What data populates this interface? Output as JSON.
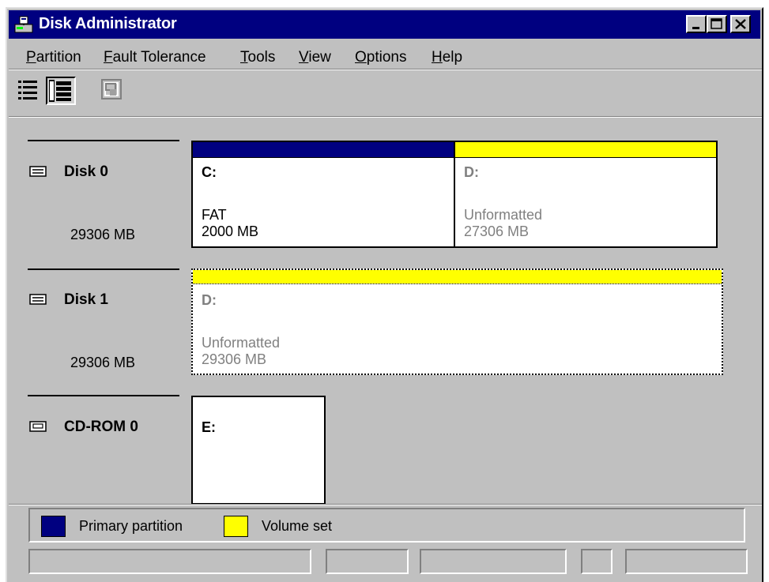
{
  "window": {
    "title": "Disk Administrator"
  },
  "menu": [
    {
      "mnemonic": "P",
      "rest": "artition"
    },
    {
      "mnemonic": "F",
      "rest": "ault Tolerance"
    },
    {
      "mnemonic": "T",
      "rest": "ools"
    },
    {
      "mnemonic": "V",
      "rest": "iew"
    },
    {
      "mnemonic": "O",
      "rest": "ptions"
    },
    {
      "mnemonic": "H",
      "rest": "elp"
    }
  ],
  "disks": [
    {
      "label": "Disk 0",
      "size": "29306 MB",
      "partitions": [
        {
          "drive": "C:",
          "fs": "FAT",
          "size": "2000 MB",
          "type": "Primary partition"
        },
        {
          "drive": "D:",
          "fs": "Unformatted",
          "size": "27306 MB",
          "type": "Volume set"
        }
      ]
    },
    {
      "label": "Disk 1",
      "size": "29306 MB",
      "partitions": [
        {
          "drive": "D:",
          "fs": "Unformatted",
          "size": "29306 MB",
          "type": "Volume set",
          "selected": true
        }
      ]
    },
    {
      "label": "CD-ROM 0",
      "partitions": [
        {
          "drive": "E:"
        }
      ]
    }
  ],
  "legend": [
    {
      "label": "Primary partition",
      "color": "#000080"
    },
    {
      "label": "Volume set",
      "color": "#ffff00"
    }
  ],
  "colors": {
    "primary": "#000080",
    "volume_set": "#ffff00",
    "titlebar": "#000080",
    "face": "#c0c0c0"
  }
}
